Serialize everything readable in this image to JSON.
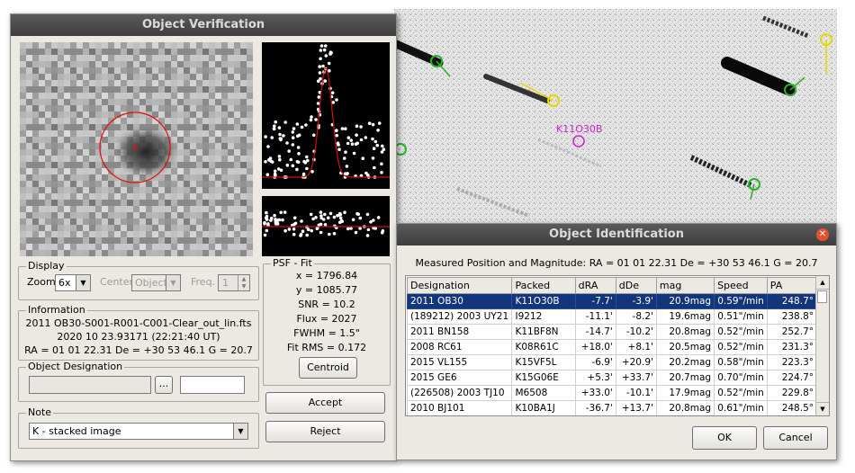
{
  "verification": {
    "title": "Object Verification",
    "display": {
      "group_label": "Display",
      "zoom_label": "Zoom",
      "zoom_value": "6x",
      "center_label": "Center",
      "center_value": "Object",
      "freq_label": "Freq.",
      "freq_value": "1"
    },
    "psf": {
      "group_label": "PSF - Fit",
      "x": "x = 1796.84",
      "y": "y = 1085.77",
      "snr": "SNR = 10.2",
      "flux": "Flux = 2027",
      "fwhm": "FWHM = 1.5\"",
      "fitrms": "Fit RMS = 0.172",
      "centroid_button": "Centroid"
    },
    "information": {
      "group_label": "Information",
      "line1": "2011 OB30-S001-R001-C001-Clear_out_lin.fts",
      "line2": "2020 10 23.93171 (22:21:40 UT)",
      "line3": "RA = 01 01 22.31   De = +30 53 46.1   G = 20.7"
    },
    "designation": {
      "group_label": "Object Designation",
      "browse_button": "...",
      "value": "",
      "extra_value": ""
    },
    "note": {
      "group_label": "Note",
      "value": "K - stacked image"
    },
    "accept_button": "Accept",
    "reject_button": "Reject"
  },
  "sky": {
    "label": "K11O30B",
    "colors": {
      "target": "#d020d0",
      "green": "#2ab02a",
      "yellow": "#e6d800"
    }
  },
  "identification": {
    "title": "Object Identification",
    "measured": "Measured Position and Magnitude: RA = 01 01 22.31   De = +30 53 46.1   G = 20.7",
    "columns": [
      "Designation",
      "Packed",
      "dRA",
      "dDe",
      "mag",
      "Speed",
      "PA"
    ],
    "rows": [
      [
        "2011 OB30",
        "K11O30B",
        "-7.7'",
        "-3.9'",
        "20.9mag",
        "0.59\"/min",
        "248.7°"
      ],
      [
        "(189212) 2003 UY21",
        "I9212",
        "-11.1'",
        "-8.2'",
        "19.6mag",
        "0.51\"/min",
        "238.8°"
      ],
      [
        "2011 BN158",
        "K11BF8N",
        "-14.7'",
        "-10.2'",
        "20.8mag",
        "0.52\"/min",
        "252.7°"
      ],
      [
        "2008 RC61",
        "K08R61C",
        "+18.0'",
        "+8.1'",
        "20.5mag",
        "0.52\"/min",
        "231.3°"
      ],
      [
        "2015 VL155",
        "K15VF5L",
        "-6.9'",
        "+20.9'",
        "20.2mag",
        "0.58\"/min",
        "223.3°"
      ],
      [
        "2015 GE6",
        "K15G06E",
        "+5.3'",
        "+33.7'",
        "20.7mag",
        "0.70\"/min",
        "224.7°"
      ],
      [
        "(226508) 2003 TJ10",
        "M6508",
        "+33.0'",
        "-10.1'",
        "17.9mag",
        "0.52\"/min",
        "229.8°"
      ],
      [
        "2010 BJ101",
        "K10BA1J",
        "-36.7'",
        "+13.7'",
        "20.8mag",
        "0.61\"/min",
        "248.5°"
      ]
    ],
    "ok_button": "OK",
    "cancel_button": "Cancel"
  }
}
